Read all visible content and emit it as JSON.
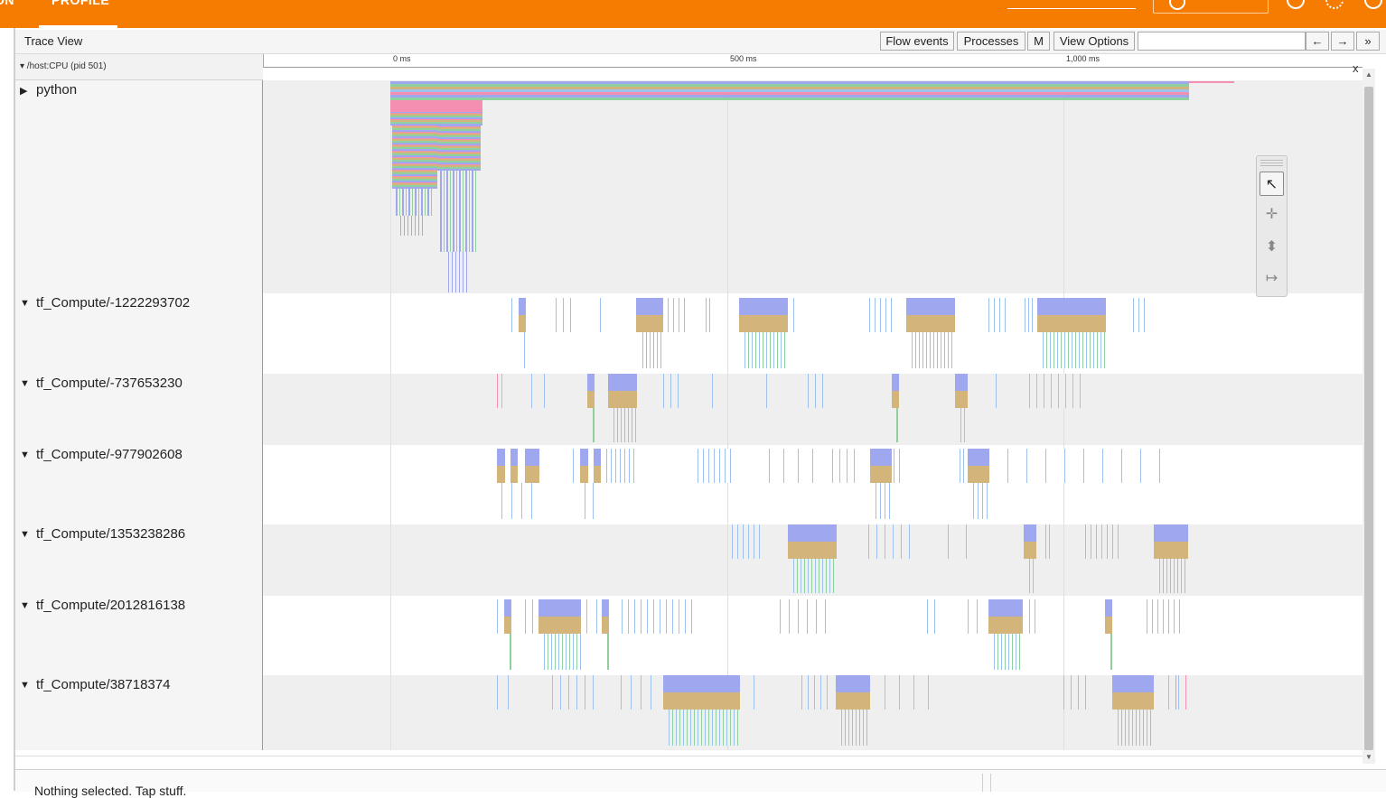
{
  "topbar": {
    "tab_left": "ON",
    "tab_active": "PROFILE"
  },
  "toolbar": {
    "title": "Trace View",
    "flow_events": "Flow events",
    "processes": "Processes",
    "m": "M",
    "view_options": "View Options",
    "search_value": "",
    "prev_arrow": "←",
    "next_arrow": "→",
    "more_arrow": "»"
  },
  "process_header": "▾ /host:CPU (pid 501)",
  "close_label": "x",
  "ruler": [
    "0 ms",
    "500 ms",
    "1,000 ms"
  ],
  "colors": {
    "topbar": "#f57c00",
    "slice_blue": "#9fa8ee",
    "slice_tan": "#d3b57c",
    "slice_pink": "#f48fb1",
    "slice_green": "#8fd19e",
    "line_blue": "#9ec2ef"
  },
  "tracks": [
    {
      "label": "python",
      "arrow": "▶"
    },
    {
      "label": "tf_Compute/-1222293702",
      "arrow": "▼"
    },
    {
      "label": "tf_Compute/-737653230",
      "arrow": "▼"
    },
    {
      "label": "tf_Compute/-977902608",
      "arrow": "▼"
    },
    {
      "label": "tf_Compute/1353238286",
      "arrow": "▼"
    },
    {
      "label": "tf_Compute/2012816138",
      "arrow": "▼"
    },
    {
      "label": "tf_Compute/38718374",
      "arrow": "▼"
    }
  ],
  "tool_icons": [
    "select-tool-icon",
    "pan-tool-icon",
    "zoom-tool-icon",
    "timing-tool-icon"
  ],
  "status": {
    "nothing_selected": "Nothing selected. Tap stuff."
  }
}
